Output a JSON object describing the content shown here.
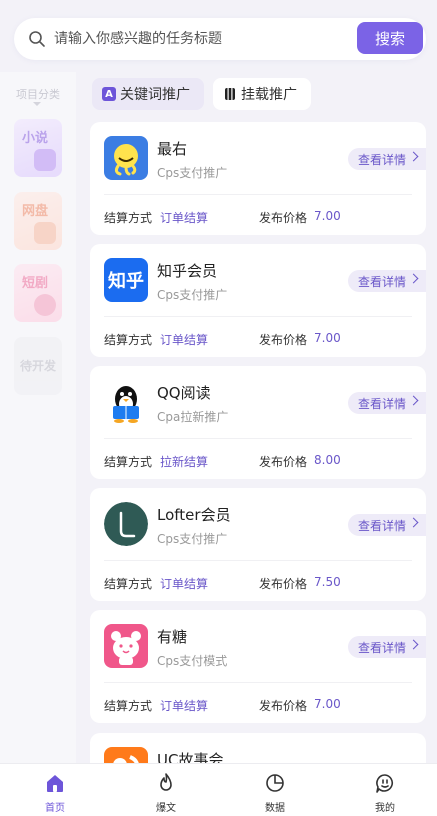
{
  "search": {
    "placeholder": "请输入你感兴趣的任务标题",
    "button_label": "搜索"
  },
  "category_sidebar": {
    "header": "项目分类",
    "tiles": [
      {
        "label": "小说"
      },
      {
        "label": "网盘"
      },
      {
        "label": "短剧"
      },
      {
        "label": "待开发"
      }
    ]
  },
  "tabs": [
    {
      "label": "关键词推广",
      "icon": "keyword-a-icon",
      "active": true
    },
    {
      "label": "挂载推广",
      "icon": "mount-icon",
      "active": false
    }
  ],
  "task_list": {
    "settle_label": "结算方式",
    "price_label": "发布价格",
    "detail_label": "查看详情",
    "items": [
      {
        "name": "最右",
        "subtype": "Cps支付推广",
        "settle": "订单结算",
        "price": "7.00",
        "logo_color": "#3b7de3"
      },
      {
        "name": "知乎会员",
        "subtype": "Cps支付推广",
        "settle": "订单结算",
        "price": "7.00",
        "logo_color": "#1b6cf0"
      },
      {
        "name": "QQ阅读",
        "subtype": "Cpa拉新推广",
        "settle": "拉新结算",
        "price": "8.00",
        "logo_color": "#ffffff"
      },
      {
        "name": "Lofter会员",
        "subtype": "Cps支付推广",
        "settle": "订单结算",
        "price": "7.50",
        "logo_color": "#2f5a55"
      },
      {
        "name": "有糖",
        "subtype": "Cps支付模式",
        "settle": "订单结算",
        "price": "7.00",
        "logo_color": "#f0578a"
      },
      {
        "name": "UC故事会",
        "logo_color": "#ff7a1a"
      }
    ]
  },
  "bottom_nav": {
    "items": [
      {
        "label": "首页",
        "icon": "home-icon",
        "active": true
      },
      {
        "label": "爆文",
        "icon": "flame-icon",
        "active": false
      },
      {
        "label": "数据",
        "icon": "pie-chart-icon",
        "active": false
      },
      {
        "label": "我的",
        "icon": "chat-bubble-icon",
        "active": false
      }
    ]
  },
  "colors": {
    "accent": "#7b63e6",
    "accent_text": "#6a57c9",
    "background": "#f3f2f8"
  }
}
